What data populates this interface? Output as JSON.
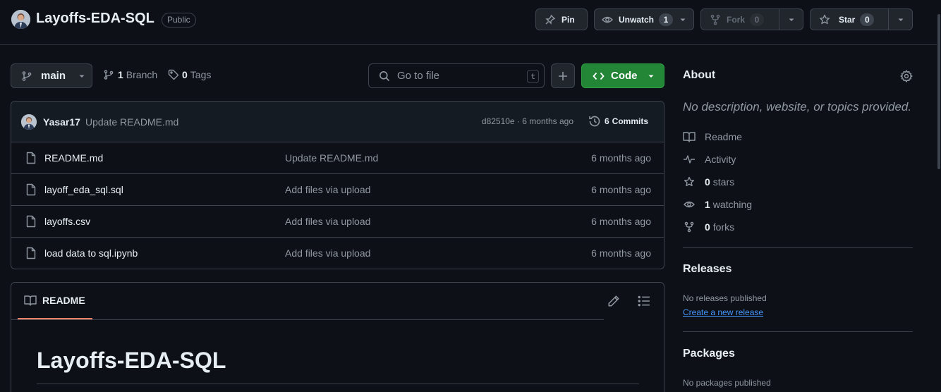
{
  "header": {
    "repo_name": "Layoffs-EDA-SQL",
    "visibility": "Public",
    "pin_label": "Pin",
    "unwatch_label": "Unwatch",
    "watch_count": "1",
    "fork_label": "Fork",
    "fork_count": "0",
    "star_label": "Star",
    "star_count": "0"
  },
  "toolbar": {
    "branch": "main",
    "branch_count": "1",
    "branch_label": "Branch",
    "tag_count": "0",
    "tag_label": "Tags",
    "search_placeholder": "Go to file",
    "search_shortcut": "t",
    "code_label": "Code"
  },
  "commit": {
    "author": "Yasar17",
    "message": "Update README.md",
    "hash_time": "d82510e · 6 months ago",
    "commits_count": "6",
    "commits_label": "Commits"
  },
  "files": [
    {
      "name": "README.md",
      "message": "Update README.md",
      "time": "6 months ago"
    },
    {
      "name": "layoff_eda_sql.sql",
      "message": "Add files via upload",
      "time": "6 months ago"
    },
    {
      "name": "layoffs.csv",
      "message": "Add files via upload",
      "time": "6 months ago"
    },
    {
      "name": "load data to sql.ipynb",
      "message": "Add files via upload",
      "time": "6 months ago"
    }
  ],
  "readme": {
    "tab_label": "README",
    "title": "Layoffs-EDA-SQL"
  },
  "sidebar": {
    "about_heading": "About",
    "about_description": "No description, website, or topics provided.",
    "readme_label": "Readme",
    "activity_label": "Activity",
    "stars_count": "0",
    "stars_label": "stars",
    "watching_count": "1",
    "watching_label": "watching",
    "forks_count": "0",
    "forks_label": "forks",
    "releases_heading": "Releases",
    "releases_text": "No releases published",
    "releases_link": "Create a new release",
    "packages_heading": "Packages",
    "packages_text": "No packages published"
  },
  "colors": {
    "background": "#0d1117",
    "border": "#3d444d",
    "accent_green": "#238636",
    "link_blue": "#4493f8",
    "tab_underline": "#f78166"
  }
}
